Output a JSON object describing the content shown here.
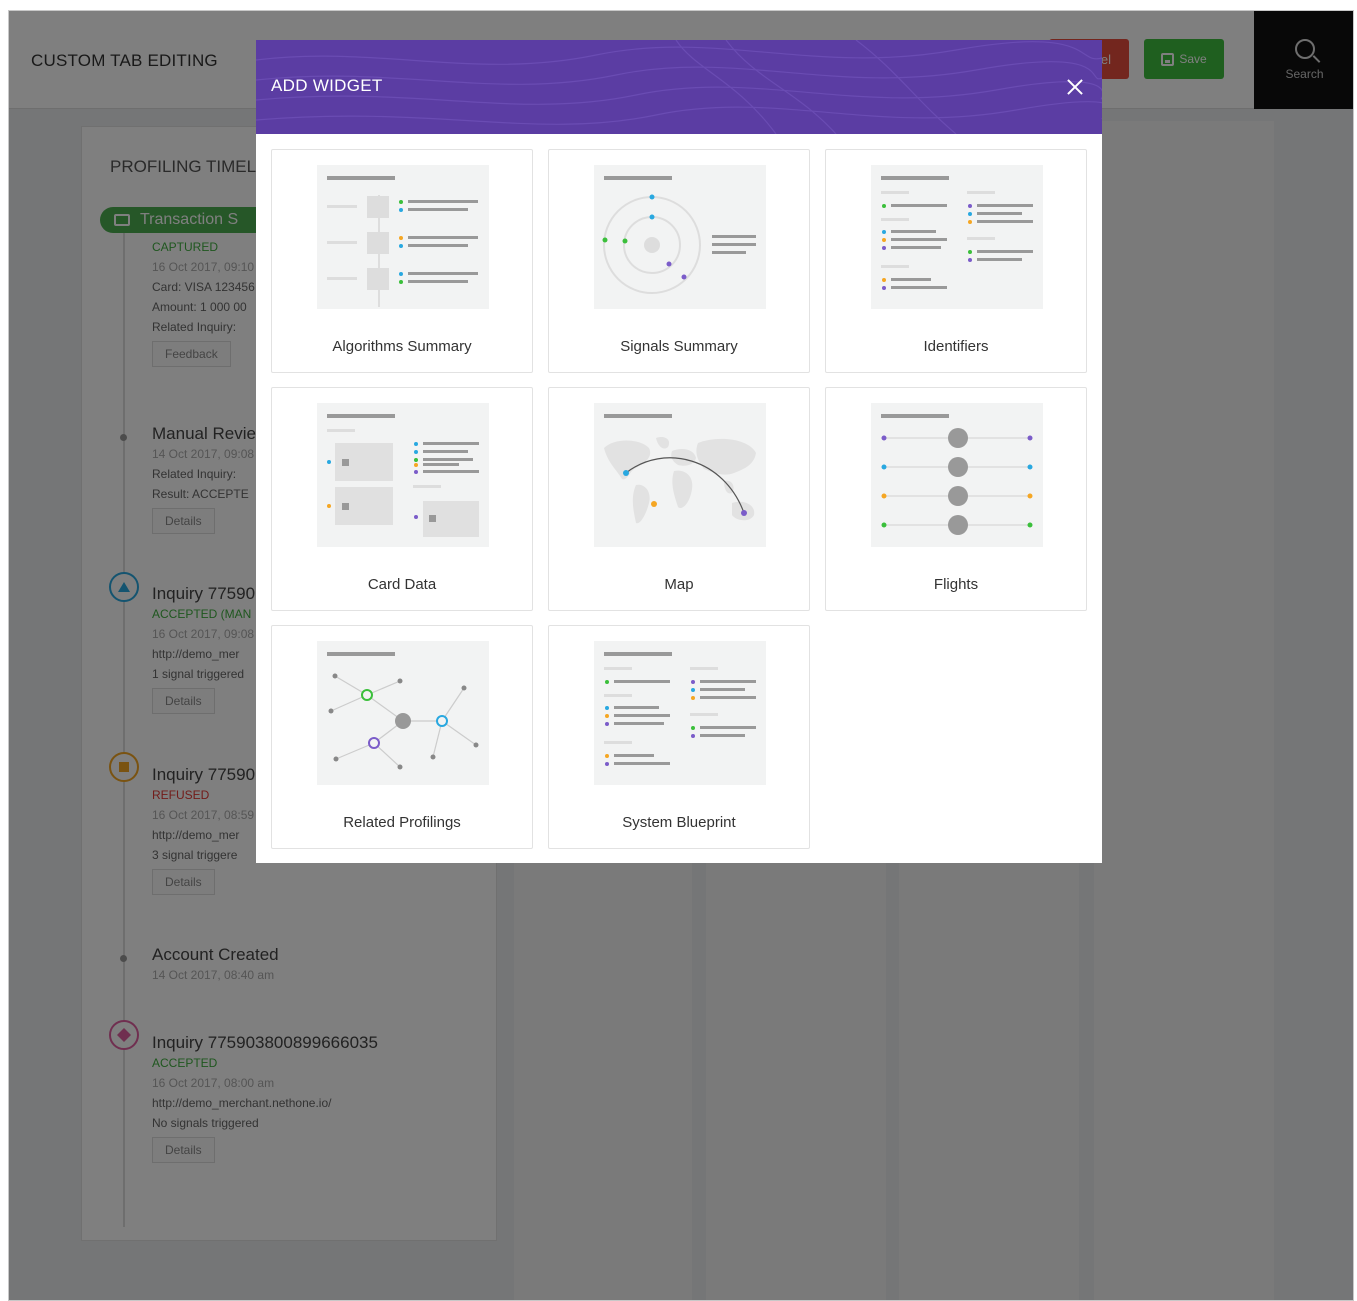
{
  "app": {
    "title": "CUSTOM TAB EDITING",
    "cancel_label": "el",
    "save_label": "Save",
    "search_label": "Search"
  },
  "timeline": {
    "heading": "PROFILING TIMEL",
    "pill_label": "Transaction S",
    "items": [
      {
        "lines": [
          "CAPTURED",
          "16 Oct 2017, 09:10",
          "Card: VISA 123456",
          "Amount: 1 000 00",
          "Related Inquiry:"
        ],
        "button": "Feedback"
      },
      {
        "name": "Manual Revie",
        "lines": [
          "14 Oct 2017, 09:08",
          "Related Inquiry:",
          "Result: ACCEPTE"
        ],
        "button": "Details"
      },
      {
        "name": "Inquiry 77590",
        "status": "ACCEPTED (MAN",
        "lines": [
          "16 Oct 2017, 09:08",
          "http://demo_mer",
          "1 signal triggered"
        ],
        "button": "Details"
      },
      {
        "name": "Inquiry 77590",
        "status": "REFUSED",
        "lines": [
          "16 Oct 2017, 08:59",
          "http://demo_mer",
          "3 signal triggere"
        ],
        "button": "Details"
      },
      {
        "name": "Account Created",
        "lines": [
          "14 Oct 2017, 08:40 am"
        ]
      },
      {
        "name": "Inquiry 775903800899666035",
        "status": "ACCEPTED",
        "lines": [
          "16 Oct 2017, 08:00 am",
          "http://demo_merchant.nethone.io/",
          "No signals triggered"
        ],
        "button": "Details"
      }
    ]
  },
  "modal": {
    "title": "ADD WIDGET",
    "close_icon": "close-icon",
    "widgets": [
      {
        "label": "Algorithms Summary"
      },
      {
        "label": "Signals Summary"
      },
      {
        "label": "Identifiers"
      },
      {
        "label": "Card Data"
      },
      {
        "label": "Map"
      },
      {
        "label": "Flights"
      },
      {
        "label": "Related Profilings"
      },
      {
        "label": "System Blueprint"
      }
    ]
  },
  "colors": {
    "header": "#5b3da3",
    "accent_blue": "#29a8e0",
    "accent_green": "#3bbf3b",
    "accent_orange": "#f5a623",
    "accent_purple": "#7b5cc9",
    "save_green": "#3fbf3f",
    "cancel_red": "#e74c3c"
  }
}
